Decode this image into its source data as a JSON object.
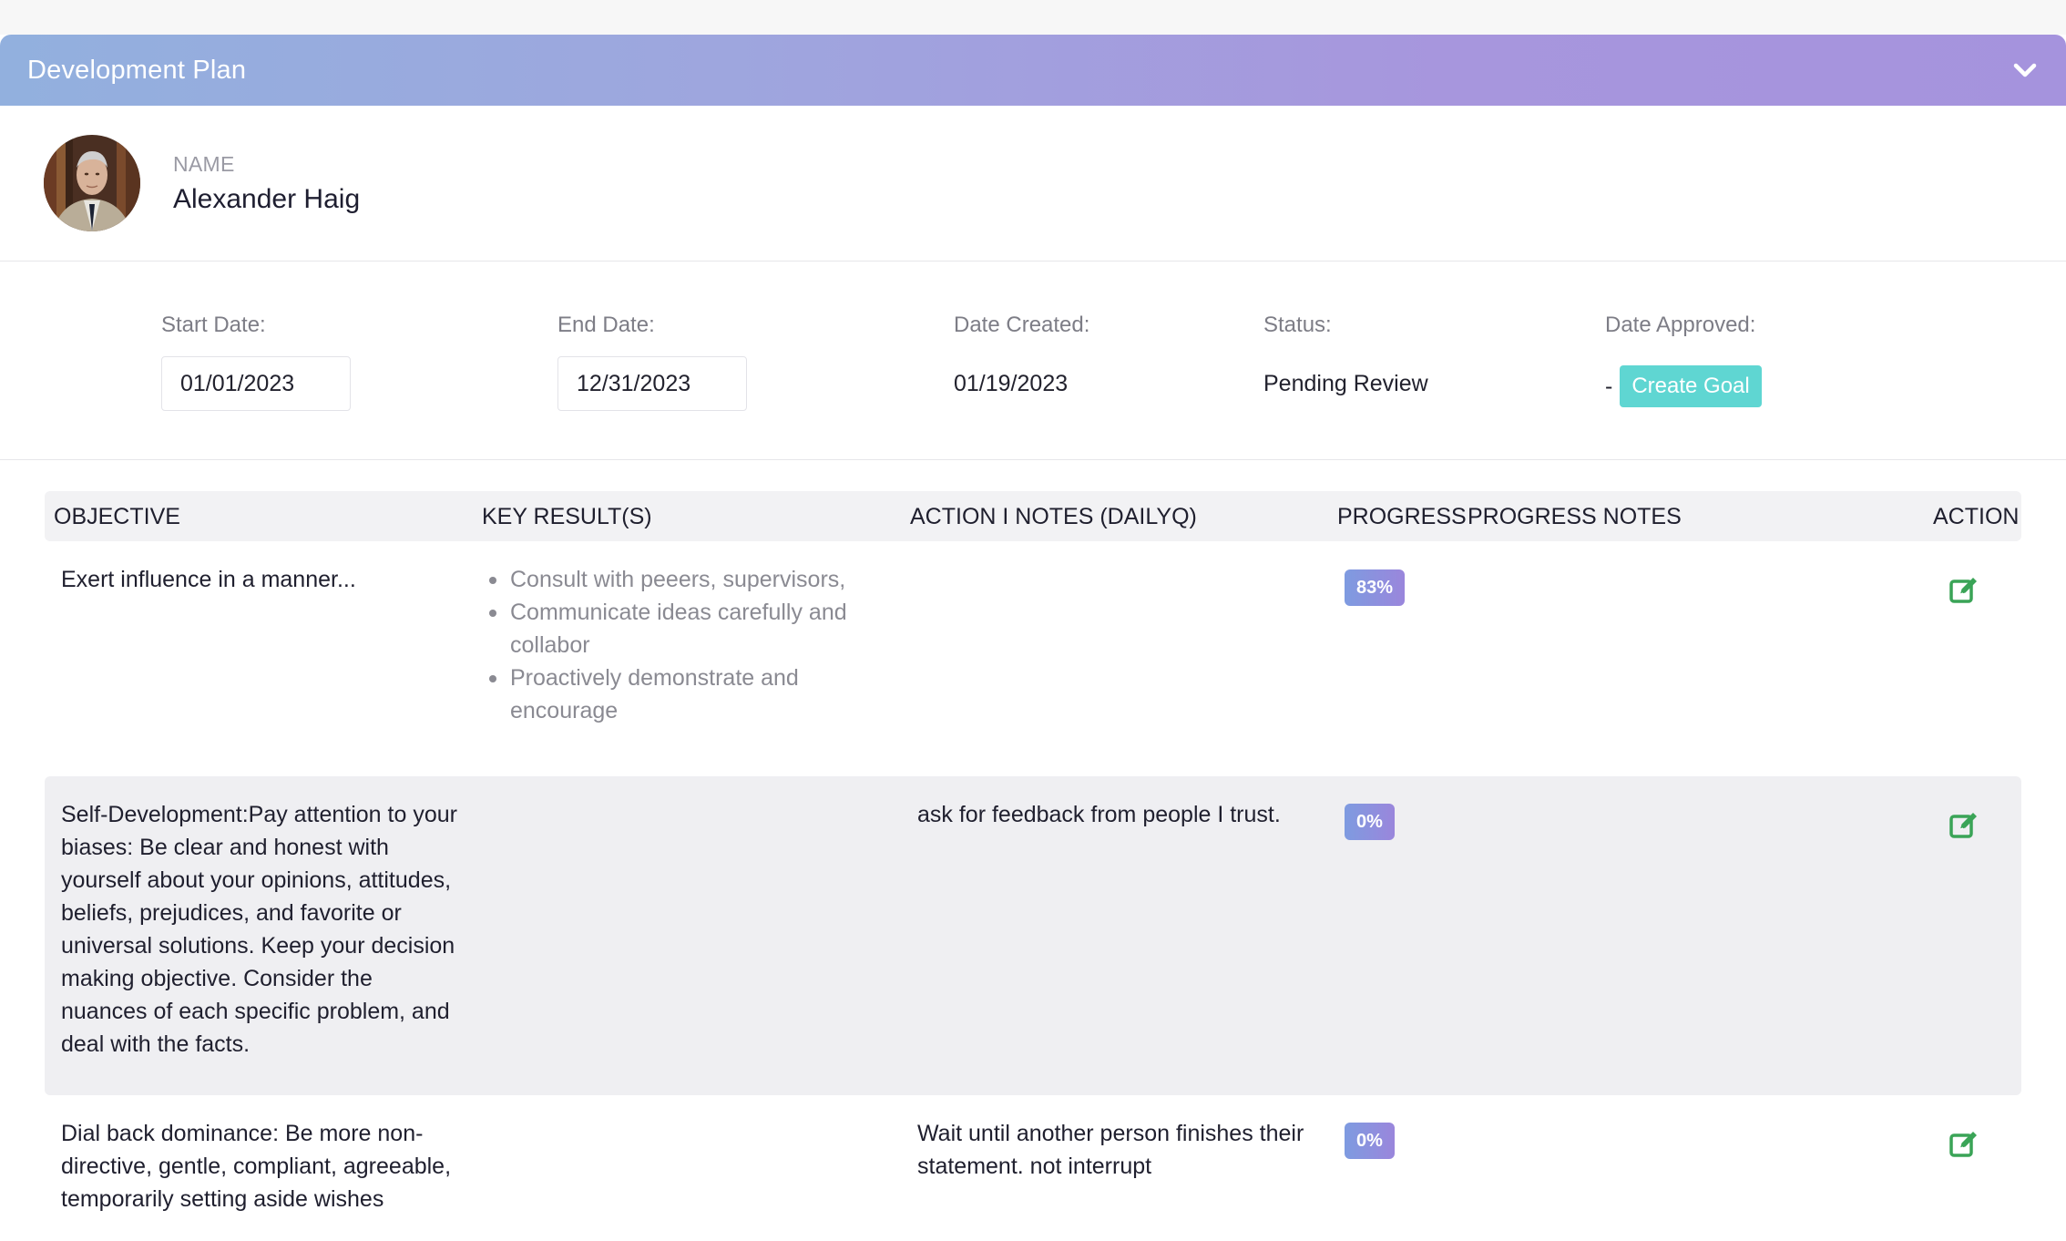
{
  "panel": {
    "title": "Development Plan"
  },
  "profile": {
    "name_label": "NAME",
    "name": "Alexander Haig"
  },
  "dates": {
    "start_label": "Start Date:",
    "start_value": "01/01/2023",
    "end_label": "End Date:",
    "end_value": "12/31/2023",
    "created_label": "Date Created:",
    "created_value": "01/19/2023",
    "status_label": "Status:",
    "status_value": "Pending Review",
    "approved_label": "Date Approved:",
    "approved_value": "-",
    "create_goal_label": "Create Goal"
  },
  "table": {
    "headers": {
      "objective": "OBJECTIVE",
      "key_results": "KEY RESULT(S)",
      "action_notes": "ACTION I NOTES (DAILYQ)",
      "progress": "PROGRESS",
      "progress_notes": "PROGRESS NOTES",
      "action": "ACTION"
    },
    "rows": [
      {
        "objective": "Exert influence in a manner...",
        "key_results": [
          "Consult with peeers, supervisors,",
          "Communicate ideas carefully and collabor",
          "Proactively demonstrate and encourage"
        ],
        "action_notes": "",
        "progress": "83%",
        "progress_notes": ""
      },
      {
        "objective": "Self-Development:Pay attention to your biases: Be clear and honest with yourself about your opinions, attitudes, beliefs, prejudices, and favorite or universal solutions. Keep your decision making objective. Consider the nuances of each specific problem, and deal with the facts.",
        "key_results": [],
        "action_notes": "ask for feedback from people I trust.",
        "progress": "0%",
        "progress_notes": ""
      },
      {
        "objective": "Dial back dominance: Be more non-directive, gentle, compliant, agreeable, temporarily setting aside wishes",
        "key_results": [],
        "action_notes": "Wait until another person finishes their statement. not interrupt",
        "progress": "0%",
        "progress_notes": ""
      }
    ]
  },
  "colors": {
    "header_gradient_start": "#92b0de",
    "header_gradient_end": "#a593dd",
    "create_goal": "#5fd6d2",
    "edit_icon": "#3aa457"
  },
  "icons": {
    "collapse": "chevron-down-icon",
    "edit": "edit-icon"
  }
}
